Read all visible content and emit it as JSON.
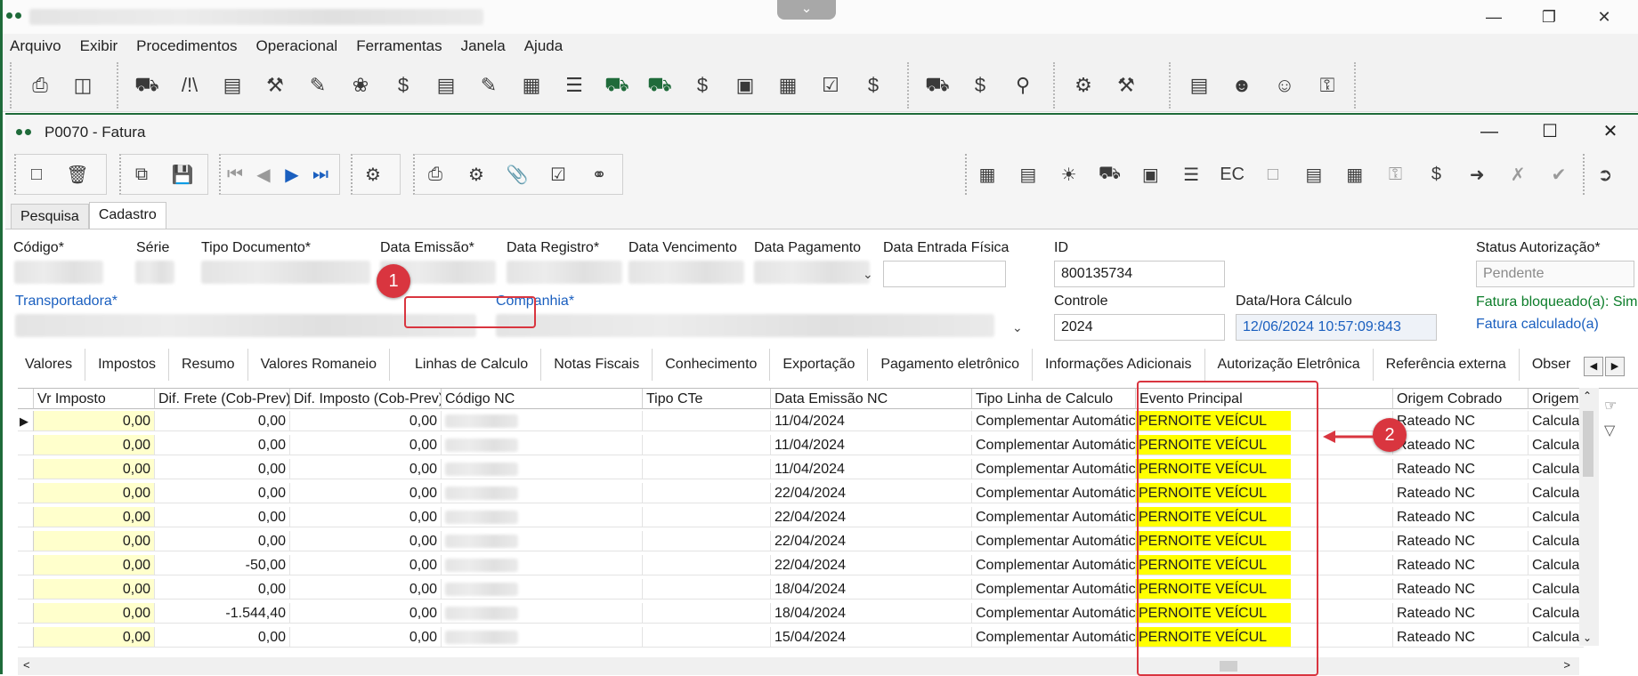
{
  "app": {
    "menu": [
      "Arquivo",
      "Exibir",
      "Procedimentos",
      "Operacional",
      "Ferramentas",
      "Janela",
      "Ajuda"
    ],
    "window_controls": [
      "—",
      "❐",
      "✕"
    ]
  },
  "window": {
    "title": "P0070 - Fatura",
    "controls": [
      "—",
      "☐",
      "✕"
    ]
  },
  "form_tabs": [
    "Pesquisa",
    "Cadastro"
  ],
  "fields": {
    "codigo_label": "Código*",
    "serie_label": "Série",
    "tipo_documento_label": "Tipo Documento*",
    "data_emissao_label": "Data Emissão*",
    "data_registro_label": "Data Registro*",
    "data_vencimento_label": "Data Vencimento",
    "data_pagamento_label": "Data Pagamento",
    "data_entrada_label": "Data Entrada Física",
    "id_label": "ID",
    "id_value": "800135734",
    "status_label": "Status Autorização*",
    "status_value": "Pendente",
    "transportadora_label": "Transportadora*",
    "companhia_label": "Companhia*",
    "controle_label": "Controle",
    "controle_value": "2024",
    "data_hora_label": "Data/Hora Cálculo",
    "data_hora_value": "12/06/2024 10:57:09:843",
    "fatura_bloqueada": "Fatura bloqueado(a): Sim",
    "fatura_calculada": "Fatura calculado(a)"
  },
  "sub_tabs": [
    "Valores",
    "Impostos",
    "Resumo",
    "Valores Romaneio",
    "Linhas de Calculo",
    "Notas Fiscais",
    "Conhecimento",
    "Exportação",
    "Pagamento eletrônico",
    "Informações Adicionais",
    "Autorização Eletrônica",
    "Referência externa",
    "Obser"
  ],
  "grid": {
    "headers": [
      "Vr Imposto",
      "Dif. Frete (Cob-Prev)",
      "Dif. Imposto (Cob-Prev)",
      "Código NC",
      "Tipo CTe",
      "Data Emissão NC",
      "Tipo Linha de Calculo",
      "Evento Principal",
      "Origem Cobrado",
      "Origem"
    ],
    "rows": [
      {
        "vr_imposto": "0,00",
        "dif_frete": "0,00",
        "dif_imposto": "0,00",
        "data": "11/04/2024",
        "tipo_linha": "Complementar Automátic",
        "evento": "PERNOITE VEÍCUL",
        "origem_cobrado": "Rateado NC",
        "origem": "Calcula"
      },
      {
        "vr_imposto": "0,00",
        "dif_frete": "0,00",
        "dif_imposto": "0,00",
        "data": "11/04/2024",
        "tipo_linha": "Complementar Automátic",
        "evento": "PERNOITE VEÍCUL",
        "origem_cobrado": "Rateado NC",
        "origem": "Calcula"
      },
      {
        "vr_imposto": "0,00",
        "dif_frete": "0,00",
        "dif_imposto": "0,00",
        "data": "11/04/2024",
        "tipo_linha": "Complementar Automátic",
        "evento": "PERNOITE VEÍCUL",
        "origem_cobrado": "Rateado NC",
        "origem": "Calcula"
      },
      {
        "vr_imposto": "0,00",
        "dif_frete": "0,00",
        "dif_imposto": "0,00",
        "data": "22/04/2024",
        "tipo_linha": "Complementar Automátic",
        "evento": "PERNOITE VEÍCUL",
        "origem_cobrado": "Rateado NC",
        "origem": "Calcula"
      },
      {
        "vr_imposto": "0,00",
        "dif_frete": "0,00",
        "dif_imposto": "0,00",
        "data": "22/04/2024",
        "tipo_linha": "Complementar Automátic",
        "evento": "PERNOITE VEÍCUL",
        "origem_cobrado": "Rateado NC",
        "origem": "Calcula"
      },
      {
        "vr_imposto": "0,00",
        "dif_frete": "0,00",
        "dif_imposto": "0,00",
        "data": "22/04/2024",
        "tipo_linha": "Complementar Automátic",
        "evento": "PERNOITE VEÍCUL",
        "origem_cobrado": "Rateado NC",
        "origem": "Calcula"
      },
      {
        "vr_imposto": "0,00",
        "dif_frete": "-50,00",
        "dif_imposto": "0,00",
        "data": "22/04/2024",
        "tipo_linha": "Complementar Automátic",
        "evento": "PERNOITE VEÍCUL",
        "origem_cobrado": "Rateado NC",
        "origem": "Calcula"
      },
      {
        "vr_imposto": "0,00",
        "dif_frete": "0,00",
        "dif_imposto": "0,00",
        "data": "18/04/2024",
        "tipo_linha": "Complementar Automátic",
        "evento": "PERNOITE VEÍCUL",
        "origem_cobrado": "Rateado NC",
        "origem": "Calcula"
      },
      {
        "vr_imposto": "0,00",
        "dif_frete": "-1.544,40",
        "dif_imposto": "0,00",
        "data": "18/04/2024",
        "tipo_linha": "Complementar Automátic",
        "evento": "PERNOITE VEÍCUL",
        "origem_cobrado": "Rateado NC",
        "origem": "Calcula"
      },
      {
        "vr_imposto": "0,00",
        "dif_frete": "0,00",
        "dif_imposto": "0,00",
        "data": "15/04/2024",
        "tipo_linha": "Complementar Automátic",
        "evento": "PERNOITE VEÍCUL",
        "origem_cobrado": "Rateado NC",
        "origem": "Calcula"
      }
    ]
  },
  "annotations": {
    "badge_1": "1",
    "badge_2": "2"
  },
  "colors": {
    "brand": "#1f6b3a",
    "highlight": "#ffff00",
    "callout": "#d9353f",
    "link": "#1a5fbf"
  }
}
